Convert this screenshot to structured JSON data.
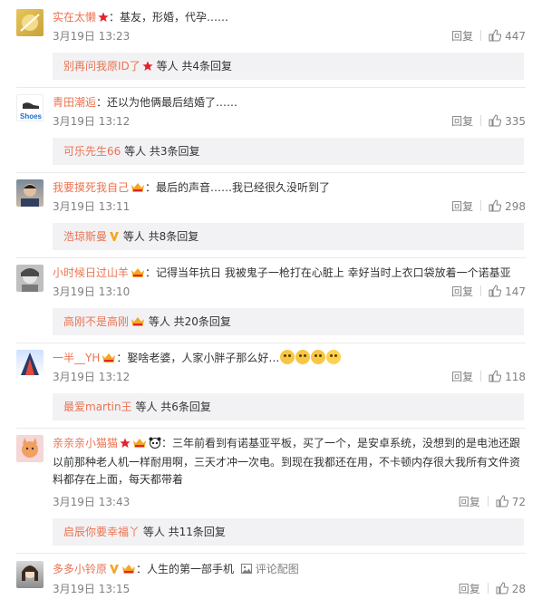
{
  "colors": {
    "link": "#eb7350",
    "muted": "#808080",
    "reply_bg": "#f2f2f5",
    "divider": "#eaeaea",
    "star": "#e5212b",
    "vip_gold": "#f5a623",
    "panda": "#222222"
  },
  "ui": {
    "reply_label": "回复",
    "like_icon": "thumbs-up-icon"
  },
  "comments": [
    {
      "user": "实在太懒",
      "sep": "：",
      "content": "基友，形婚，代孕……",
      "time": "3月19日 13:23",
      "likes": "447",
      "replies": {
        "first_user": "别再问我原ID了",
        "summary": "等人 共4条回复"
      }
    },
    {
      "user": "青田潮逅",
      "sep": "：",
      "content": "还以为他俩最后结婚了……",
      "time": "3月19日 13:12",
      "likes": "335",
      "replies": {
        "first_user": "可乐先生66",
        "summary": "等人 共3条回复"
      }
    },
    {
      "user": "我要摸死我自己",
      "sep": "：",
      "content": "最后的声音……我已经很久没听到了",
      "time": "3月19日 13:11",
      "likes": "298",
      "replies": {
        "first_user": "浩琼斯曼",
        "summary": "等人 共8条回复"
      }
    },
    {
      "user": "小时候日过山羊",
      "sep": "：",
      "content": "记得当年抗日 我被鬼子一枪打在心脏上 幸好当时上衣口袋放着一个诺基亚",
      "time": "3月19日 13:10",
      "likes": "147",
      "replies": {
        "first_user": "高刚不是高刚",
        "summary": "等人 共20条回复"
      }
    },
    {
      "user": "一半__YH",
      "sep": "：",
      "content": "娶啥老婆，人家小胖子那么好…",
      "time": "3月19日 13:12",
      "likes": "118",
      "replies": {
        "first_user": "最爱martin王",
        "summary": "等人 共6条回复"
      }
    },
    {
      "user": "亲亲亲小猫猫",
      "sep": "：",
      "content": "三年前看到有诺基亚平板，买了一个，是安卓系统，没想到的是电池还跟以前那种老人机一样耐用啊，三天才冲一次电。到现在我都还在用，不卡顿内存很大我所有文件资料都存在上面，每天都带着",
      "time": "3月19日 13:43",
      "likes": "72",
      "replies": {
        "first_user": "启辰你要幸福丫",
        "summary": "等人 共11条回复"
      }
    },
    {
      "user": "多多小铃原",
      "sep": "：",
      "content": "人生的第一部手机",
      "picture_label": "评论配图",
      "time": "3月19日 13:15",
      "likes": "28"
    }
  ]
}
